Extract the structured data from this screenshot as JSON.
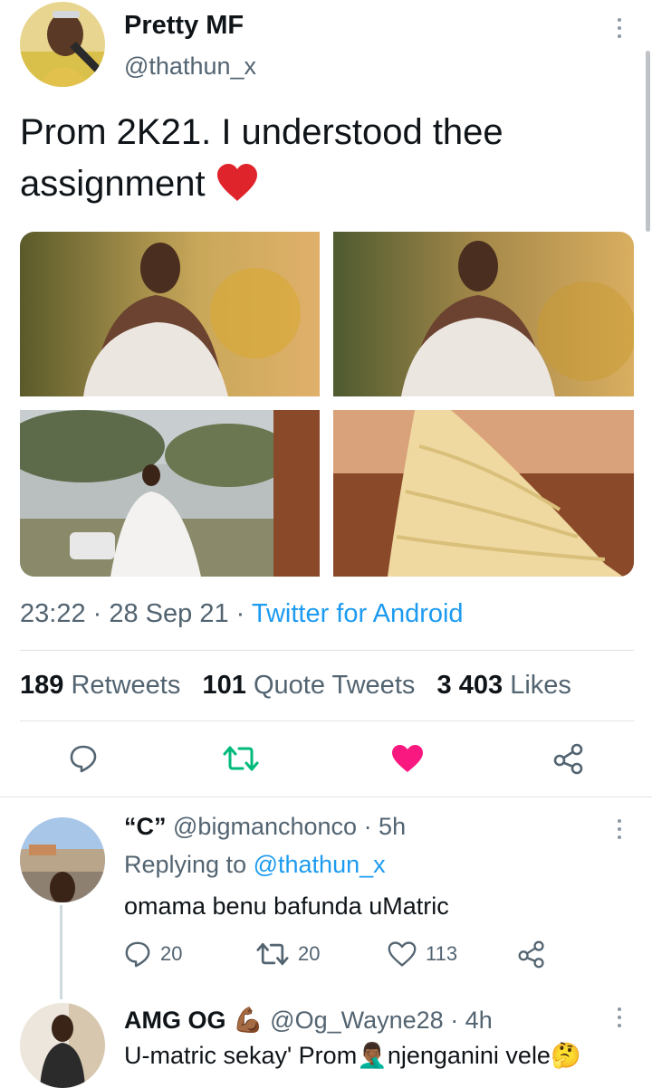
{
  "tweet": {
    "author_name": "Pretty MF",
    "author_handle": "@thathun_x",
    "text_line1": "Prom 2K21. I understood thee",
    "text_line2": "assignment",
    "text_emoji": "❤️",
    "time": "23:22",
    "dot1": " · ",
    "date": "28 Sep 21",
    "dot2": " · ",
    "source": "Twitter for Android",
    "stats": {
      "retweets_count": "189",
      "retweets_label": "Retweets",
      "quotes_count": "101",
      "quotes_label": "Quote Tweets",
      "likes_count": "3 403",
      "likes_label": "Likes"
    }
  },
  "replies": [
    {
      "name": "“C”",
      "handle": "@bigmanchonco",
      "time": "· 5h",
      "replying_label": "Replying to",
      "replying_handle": "@thathun_x",
      "text": "omama benu bafunda uMatric",
      "reply_count": "20",
      "retweet_count": "20",
      "like_count": "113"
    },
    {
      "name": "AMG OG",
      "name_emoji": "💪🏾",
      "handle": "@Og_Wayne28",
      "time": "· 4h",
      "text": "U-matric sekay' Prom",
      "text_emoji1": "🤦🏾‍♂️",
      "text2": "njenganini vele",
      "text_emoji2": "🤔"
    }
  ],
  "colors": {
    "link": "#1d9bf0",
    "retweet": "#00ba7c",
    "like": "#f91880",
    "muted": "#536471"
  }
}
